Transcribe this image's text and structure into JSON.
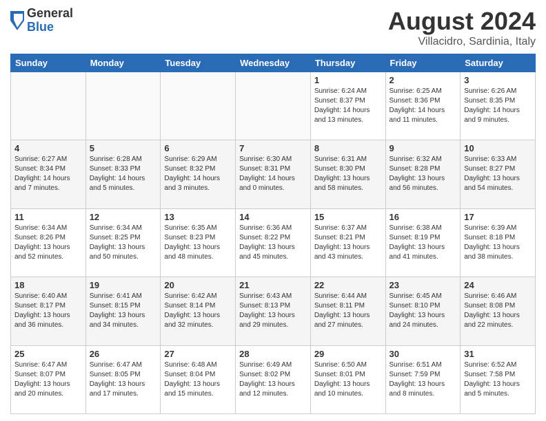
{
  "logo": {
    "general": "General",
    "blue": "Blue"
  },
  "header": {
    "month": "August 2024",
    "location": "Villacidro, Sardinia, Italy"
  },
  "days": [
    "Sunday",
    "Monday",
    "Tuesday",
    "Wednesday",
    "Thursday",
    "Friday",
    "Saturday"
  ],
  "weeks": [
    [
      {
        "day": "",
        "info": ""
      },
      {
        "day": "",
        "info": ""
      },
      {
        "day": "",
        "info": ""
      },
      {
        "day": "",
        "info": ""
      },
      {
        "day": "1",
        "info": "Sunrise: 6:24 AM\nSunset: 8:37 PM\nDaylight: 14 hours\nand 13 minutes."
      },
      {
        "day": "2",
        "info": "Sunrise: 6:25 AM\nSunset: 8:36 PM\nDaylight: 14 hours\nand 11 minutes."
      },
      {
        "day": "3",
        "info": "Sunrise: 6:26 AM\nSunset: 8:35 PM\nDaylight: 14 hours\nand 9 minutes."
      }
    ],
    [
      {
        "day": "4",
        "info": "Sunrise: 6:27 AM\nSunset: 8:34 PM\nDaylight: 14 hours\nand 7 minutes."
      },
      {
        "day": "5",
        "info": "Sunrise: 6:28 AM\nSunset: 8:33 PM\nDaylight: 14 hours\nand 5 minutes."
      },
      {
        "day": "6",
        "info": "Sunrise: 6:29 AM\nSunset: 8:32 PM\nDaylight: 14 hours\nand 3 minutes."
      },
      {
        "day": "7",
        "info": "Sunrise: 6:30 AM\nSunset: 8:31 PM\nDaylight: 14 hours\nand 0 minutes."
      },
      {
        "day": "8",
        "info": "Sunrise: 6:31 AM\nSunset: 8:30 PM\nDaylight: 13 hours\nand 58 minutes."
      },
      {
        "day": "9",
        "info": "Sunrise: 6:32 AM\nSunset: 8:28 PM\nDaylight: 13 hours\nand 56 minutes."
      },
      {
        "day": "10",
        "info": "Sunrise: 6:33 AM\nSunset: 8:27 PM\nDaylight: 13 hours\nand 54 minutes."
      }
    ],
    [
      {
        "day": "11",
        "info": "Sunrise: 6:34 AM\nSunset: 8:26 PM\nDaylight: 13 hours\nand 52 minutes."
      },
      {
        "day": "12",
        "info": "Sunrise: 6:34 AM\nSunset: 8:25 PM\nDaylight: 13 hours\nand 50 minutes."
      },
      {
        "day": "13",
        "info": "Sunrise: 6:35 AM\nSunset: 8:23 PM\nDaylight: 13 hours\nand 48 minutes."
      },
      {
        "day": "14",
        "info": "Sunrise: 6:36 AM\nSunset: 8:22 PM\nDaylight: 13 hours\nand 45 minutes."
      },
      {
        "day": "15",
        "info": "Sunrise: 6:37 AM\nSunset: 8:21 PM\nDaylight: 13 hours\nand 43 minutes."
      },
      {
        "day": "16",
        "info": "Sunrise: 6:38 AM\nSunset: 8:19 PM\nDaylight: 13 hours\nand 41 minutes."
      },
      {
        "day": "17",
        "info": "Sunrise: 6:39 AM\nSunset: 8:18 PM\nDaylight: 13 hours\nand 38 minutes."
      }
    ],
    [
      {
        "day": "18",
        "info": "Sunrise: 6:40 AM\nSunset: 8:17 PM\nDaylight: 13 hours\nand 36 minutes."
      },
      {
        "day": "19",
        "info": "Sunrise: 6:41 AM\nSunset: 8:15 PM\nDaylight: 13 hours\nand 34 minutes."
      },
      {
        "day": "20",
        "info": "Sunrise: 6:42 AM\nSunset: 8:14 PM\nDaylight: 13 hours\nand 32 minutes."
      },
      {
        "day": "21",
        "info": "Sunrise: 6:43 AM\nSunset: 8:13 PM\nDaylight: 13 hours\nand 29 minutes."
      },
      {
        "day": "22",
        "info": "Sunrise: 6:44 AM\nSunset: 8:11 PM\nDaylight: 13 hours\nand 27 minutes."
      },
      {
        "day": "23",
        "info": "Sunrise: 6:45 AM\nSunset: 8:10 PM\nDaylight: 13 hours\nand 24 minutes."
      },
      {
        "day": "24",
        "info": "Sunrise: 6:46 AM\nSunset: 8:08 PM\nDaylight: 13 hours\nand 22 minutes."
      }
    ],
    [
      {
        "day": "25",
        "info": "Sunrise: 6:47 AM\nSunset: 8:07 PM\nDaylight: 13 hours\nand 20 minutes."
      },
      {
        "day": "26",
        "info": "Sunrise: 6:47 AM\nSunset: 8:05 PM\nDaylight: 13 hours\nand 17 minutes."
      },
      {
        "day": "27",
        "info": "Sunrise: 6:48 AM\nSunset: 8:04 PM\nDaylight: 13 hours\nand 15 minutes."
      },
      {
        "day": "28",
        "info": "Sunrise: 6:49 AM\nSunset: 8:02 PM\nDaylight: 13 hours\nand 12 minutes."
      },
      {
        "day": "29",
        "info": "Sunrise: 6:50 AM\nSunset: 8:01 PM\nDaylight: 13 hours\nand 10 minutes."
      },
      {
        "day": "30",
        "info": "Sunrise: 6:51 AM\nSunset: 7:59 PM\nDaylight: 13 hours\nand 8 minutes."
      },
      {
        "day": "31",
        "info": "Sunrise: 6:52 AM\nSunset: 7:58 PM\nDaylight: 13 hours\nand 5 minutes."
      }
    ]
  ]
}
